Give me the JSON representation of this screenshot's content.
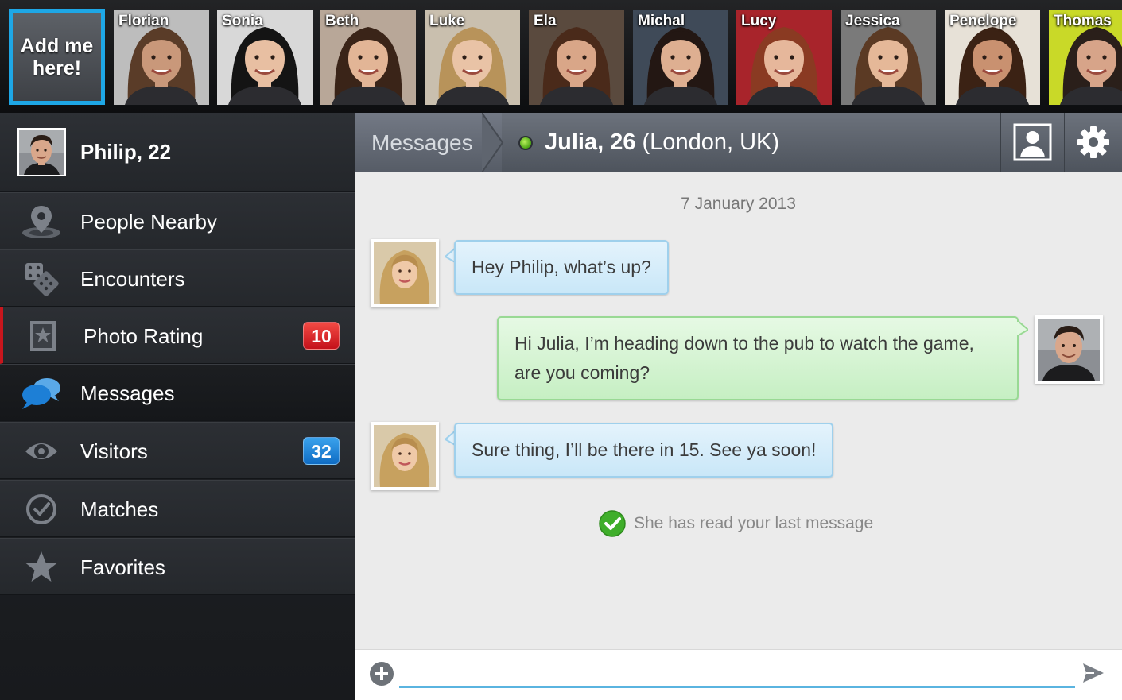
{
  "top_strip": {
    "add_me_label": "Add me here!",
    "people": [
      {
        "name": "Florian",
        "skin": "#c9987a",
        "hair": "#5a3c28",
        "bg": "#bdbdbd"
      },
      {
        "name": "Sonia",
        "skin": "#e8bfa2",
        "hair": "#141414",
        "bg": "#d8d8d8"
      },
      {
        "name": "Beth",
        "skin": "#e2b596",
        "hair": "#3a2418",
        "bg": "#b8a798"
      },
      {
        "name": "Luke",
        "skin": "#e9c3a6",
        "hair": "#b8935a",
        "bg": "#c9bfae"
      },
      {
        "name": "Ela",
        "skin": "#d9a688",
        "hair": "#4a2a1a",
        "bg": "#5a4a3e"
      },
      {
        "name": "Michal",
        "skin": "#deaf91",
        "hair": "#231713",
        "bg": "#3f4a58"
      },
      {
        "name": "Lucy",
        "skin": "#e6b79b",
        "hair": "#8a3a22",
        "bg": "#a8242b"
      },
      {
        "name": "Jessica",
        "skin": "#e5b898",
        "hair": "#5b3a24",
        "bg": "#7a7a7a"
      },
      {
        "name": "Penelope",
        "skin": "#c99170",
        "hair": "#3b2214",
        "bg": "#e7e1d7"
      },
      {
        "name": "Thomas",
        "skin": "#d7a489",
        "hair": "#2a1f1a",
        "bg": "#c9d928"
      }
    ]
  },
  "sidebar": {
    "profile_name": "Philip, 22",
    "items": [
      {
        "label": "People Nearby",
        "icon": "location-pin-icon",
        "badge": ""
      },
      {
        "label": "Encounters",
        "icon": "dice-icon",
        "badge": ""
      },
      {
        "label": "Photo Rating",
        "icon": "star-photo-icon",
        "badge": "10"
      },
      {
        "label": "Messages",
        "icon": "chat-bubbles-icon",
        "badge": ""
      },
      {
        "label": "Visitors",
        "icon": "eye-icon",
        "badge": "32"
      },
      {
        "label": "Matches",
        "icon": "check-circle-icon",
        "badge": ""
      },
      {
        "label": "Favorites",
        "icon": "star-icon",
        "badge": ""
      }
    ]
  },
  "header": {
    "back_label": "Messages",
    "chat_name": "Julia, 26",
    "chat_location": " (London, UK)",
    "accent": "#1ea7e6"
  },
  "chat": {
    "date": "7 January 2013",
    "messages": [
      {
        "from": "Julia",
        "text": "Hey Philip, what’s up?"
      },
      {
        "from": "Philip",
        "text": "Hi Julia, I’m heading down to the pub to watch the game, are you coming?"
      },
      {
        "from": "Julia",
        "text": "Sure thing, I’ll be there in 15. See ya soon!"
      }
    ],
    "read_receipt": "She has read your last message"
  },
  "composer": {
    "value": "",
    "placeholder": ""
  }
}
